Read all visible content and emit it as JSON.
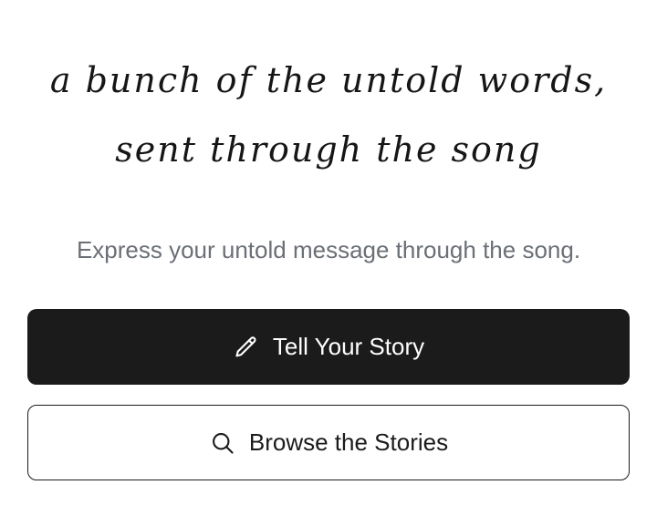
{
  "hero": {
    "line1": "a bunch of the untold words,",
    "line2": "sent through the song"
  },
  "subtitle": "Express your untold message through the song.",
  "actions": {
    "tell": {
      "label": "Tell Your Story",
      "icon": "pencil-icon"
    },
    "browse": {
      "label": "Browse the Stories",
      "icon": "search-icon"
    }
  },
  "colors": {
    "primary_bg": "#1b1b1b",
    "primary_text": "#ffffff",
    "subtitle_text": "#6b6f76"
  }
}
